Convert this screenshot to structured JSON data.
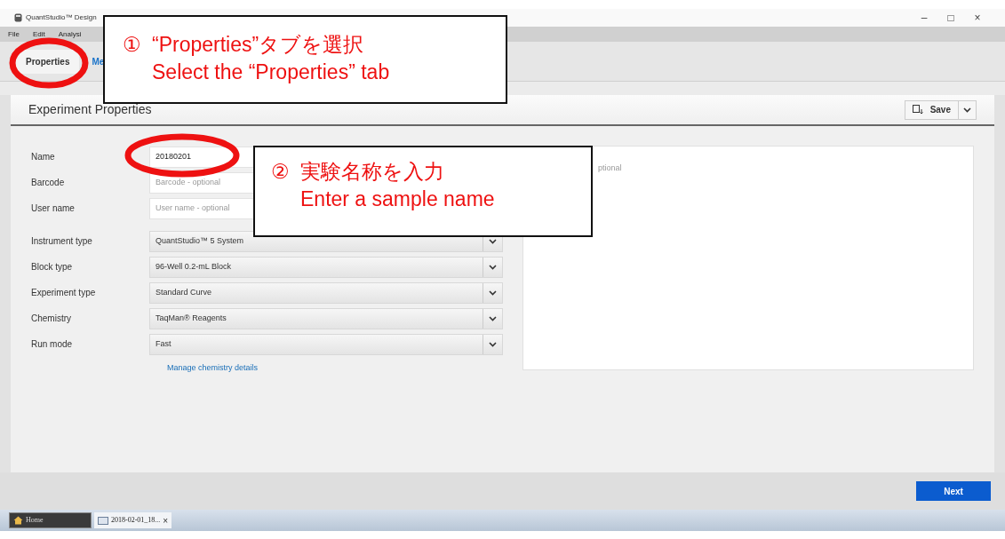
{
  "window": {
    "title": "QuantStudio™ Design",
    "controls": [
      "–",
      "□",
      "×"
    ]
  },
  "menu": [
    "File",
    "Edit",
    "Analysi"
  ],
  "tabs": [
    {
      "label": "Properties",
      "selected": true
    },
    {
      "label": "Me",
      "selected": false
    }
  ],
  "panel": {
    "title": "Experiment Properties",
    "save_button": "Save"
  },
  "fields": [
    {
      "kind": "text",
      "label": "Name",
      "value": "20180201"
    },
    {
      "kind": "text",
      "label": "Barcode",
      "placeholder": "Barcode - optional"
    },
    {
      "kind": "text",
      "label": "User name",
      "placeholder": "User name - optional"
    },
    {
      "kind": "select",
      "label": "Instrument type",
      "value": "QuantStudio™ 5 System"
    },
    {
      "kind": "select",
      "label": "Block type",
      "value": "96-Well 0.2-mL Block"
    },
    {
      "kind": "select",
      "label": "Experiment type",
      "value": "Standard Curve"
    },
    {
      "kind": "select",
      "label": "Chemistry",
      "value": "TaqMan® Reagents"
    },
    {
      "kind": "select",
      "label": "Run mode",
      "value": "Fast"
    }
  ],
  "manage_link": "Manage chemistry details",
  "description": {
    "placeholder": "ptional"
  },
  "next_button": "Next",
  "taskbar": [
    {
      "label": "Home",
      "selected": false,
      "kind": "home"
    },
    {
      "label": "2018-02-01_18...",
      "selected": true,
      "kind": "file",
      "close": "×"
    }
  ],
  "callouts": [
    {
      "marker": "①",
      "lines": [
        "“Properties”タブを選択",
        "Select the “Properties” tab"
      ]
    },
    {
      "marker": "②",
      "lines": [
        "実験名称を入力",
        "Enter a sample name"
      ]
    }
  ]
}
